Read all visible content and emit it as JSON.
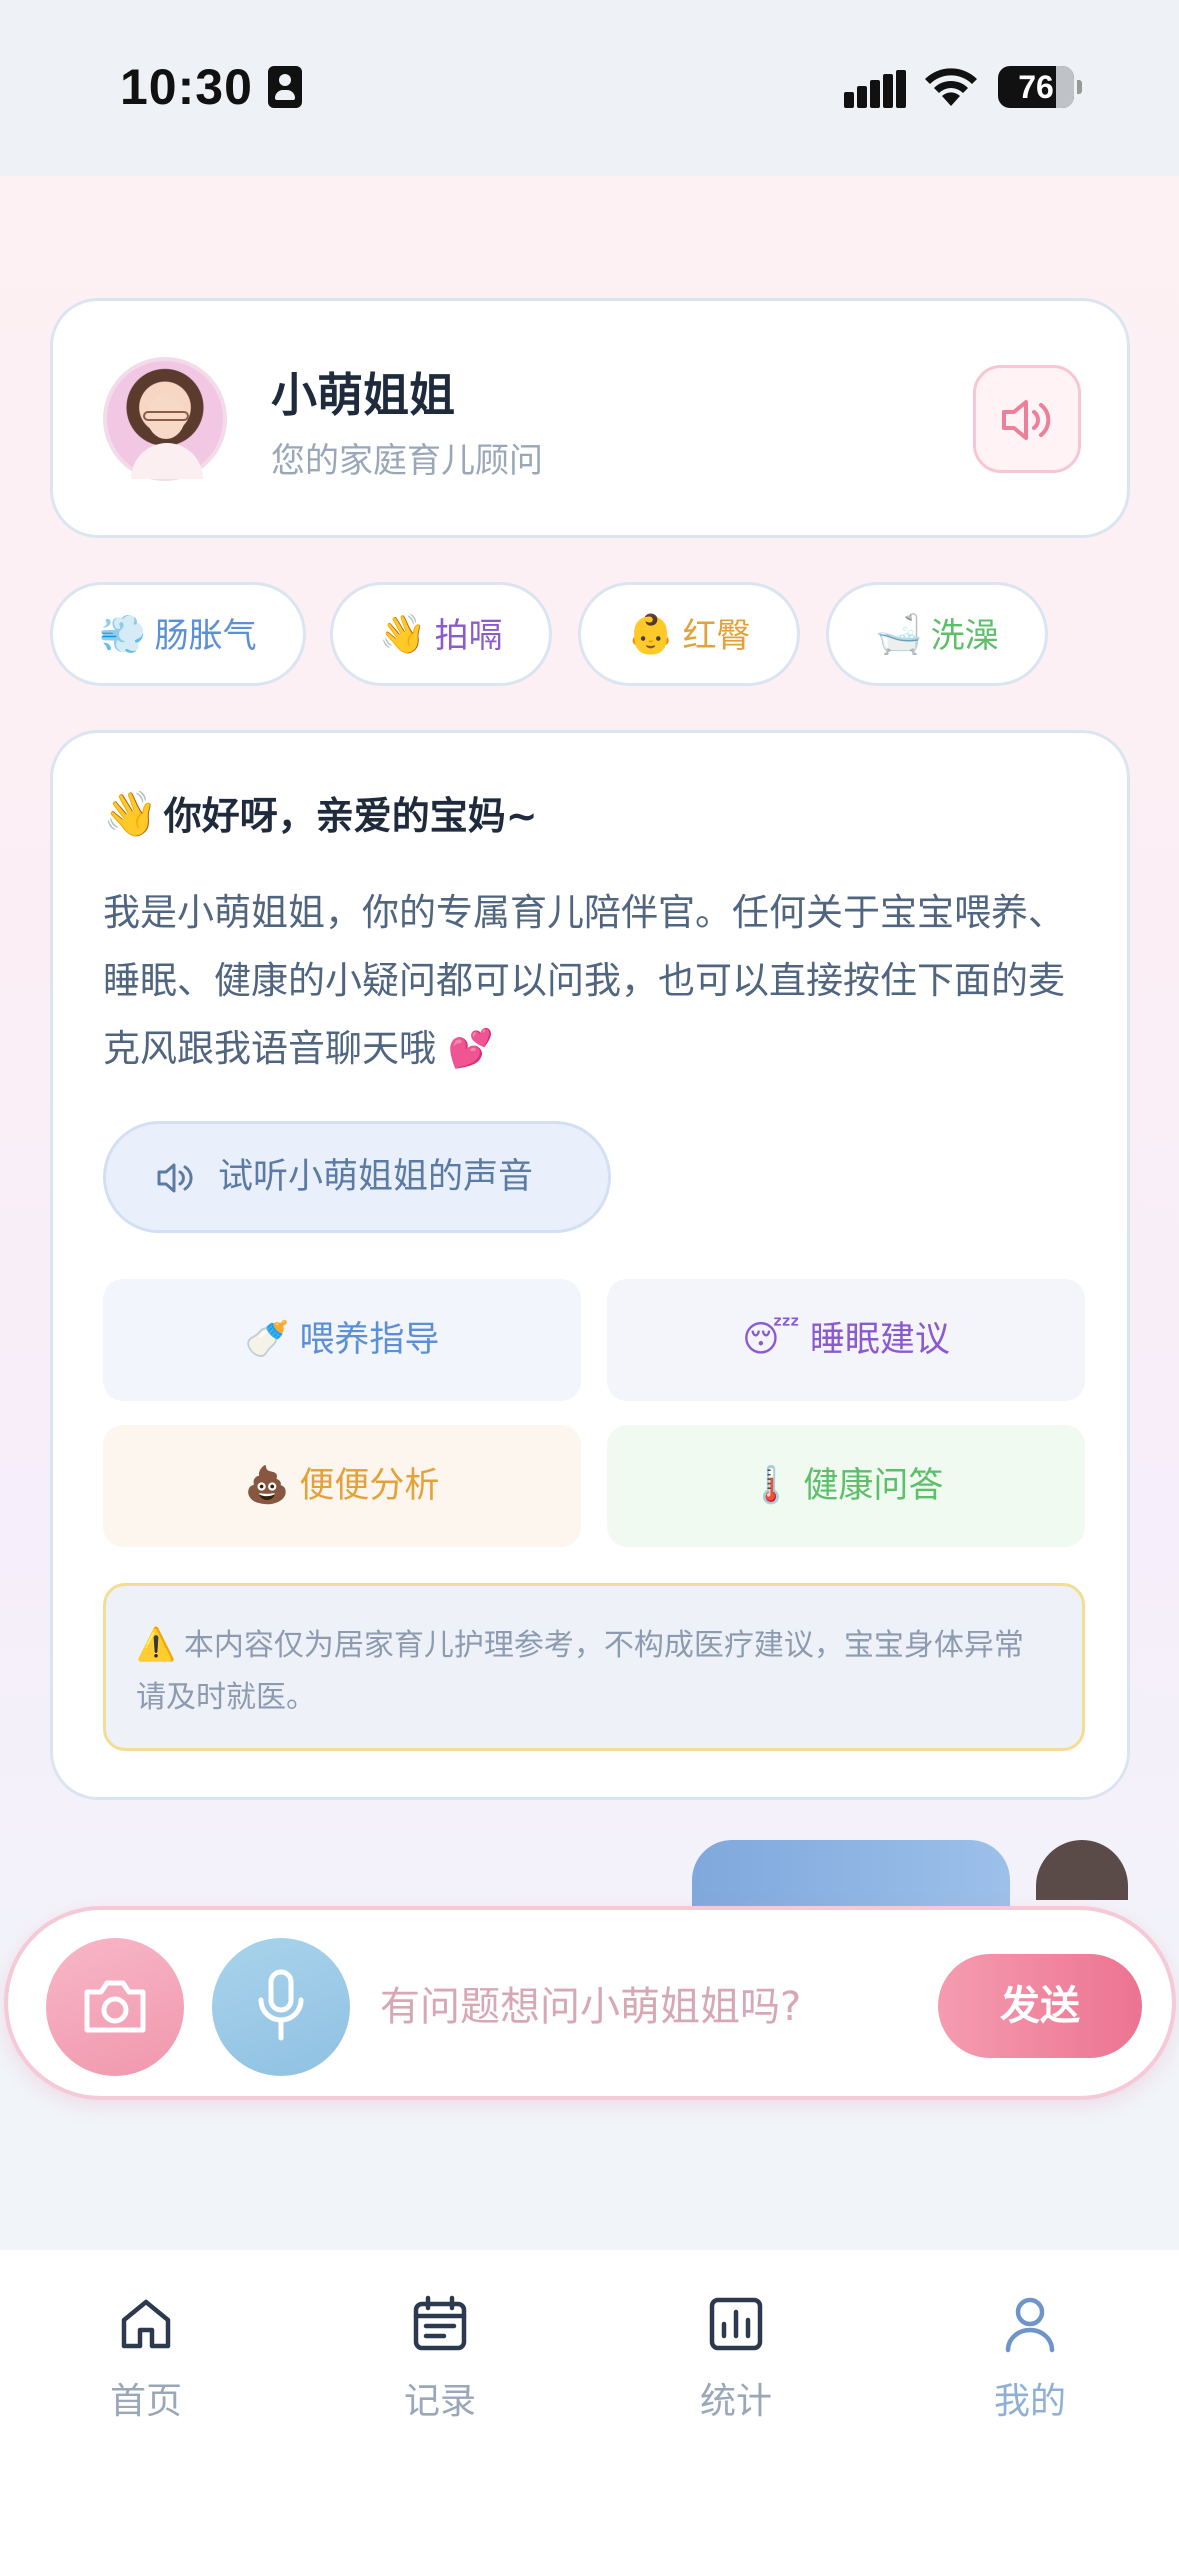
{
  "status_bar": {
    "time": "10:30",
    "battery": "76"
  },
  "header": {
    "name": "小萌姐姐",
    "subtitle": "您的家庭育儿顾问"
  },
  "quick_chips": [
    {
      "emoji": "💨",
      "label": "肠胀气",
      "color": "#5b8fd6"
    },
    {
      "emoji": "👋",
      "label": "拍嗝",
      "color": "#8a5ad0"
    },
    {
      "emoji": "👶",
      "label": "红臀",
      "color": "#e3a13a"
    },
    {
      "emoji": "🛁",
      "label": "洗澡",
      "color": "#5cbf6a"
    }
  ],
  "message": {
    "greeting_emoji": "👋",
    "greeting": "你好呀，亲爱的宝妈~",
    "intro": "我是小萌姐姐，你的专属育儿陪伴官。任何关于宝宝喂养、睡眠、健康的小疑问都可以问我，也可以直接按住下面的麦克风跟我语音聊天哦 💕",
    "listen_button": "试听小萌姐姐的声音",
    "quick_topics": [
      {
        "emoji": "🍼",
        "label": "喂养指导",
        "color": "#5b8fd6",
        "bg": "#f2f6fc"
      },
      {
        "emoji": "😴",
        "label": "睡眠建议",
        "color": "#8a5ad0",
        "bg": "#f4f5fb"
      },
      {
        "emoji": "💩",
        "label": "便便分析",
        "color": "#e3a13a",
        "bg": "#fdf6ee"
      },
      {
        "emoji": "🌡️",
        "label": "健康问答",
        "color": "#5cbf6a",
        "bg": "#f1faf1"
      }
    ],
    "warning_emoji": "⚠️",
    "warning": "本内容仅为居家育儿护理参考，不构成医疗建议，宝宝身体异常请及时就医。"
  },
  "input": {
    "placeholder": "有问题想问小萌姐姐吗?",
    "value": "",
    "send_label": "发送"
  },
  "tabs": [
    {
      "label": "首页",
      "icon": "home-icon"
    },
    {
      "label": "记录",
      "icon": "calendar-icon"
    },
    {
      "label": "统计",
      "icon": "chart-icon"
    },
    {
      "label": "我的",
      "icon": "user-icon",
      "active": true
    }
  ]
}
